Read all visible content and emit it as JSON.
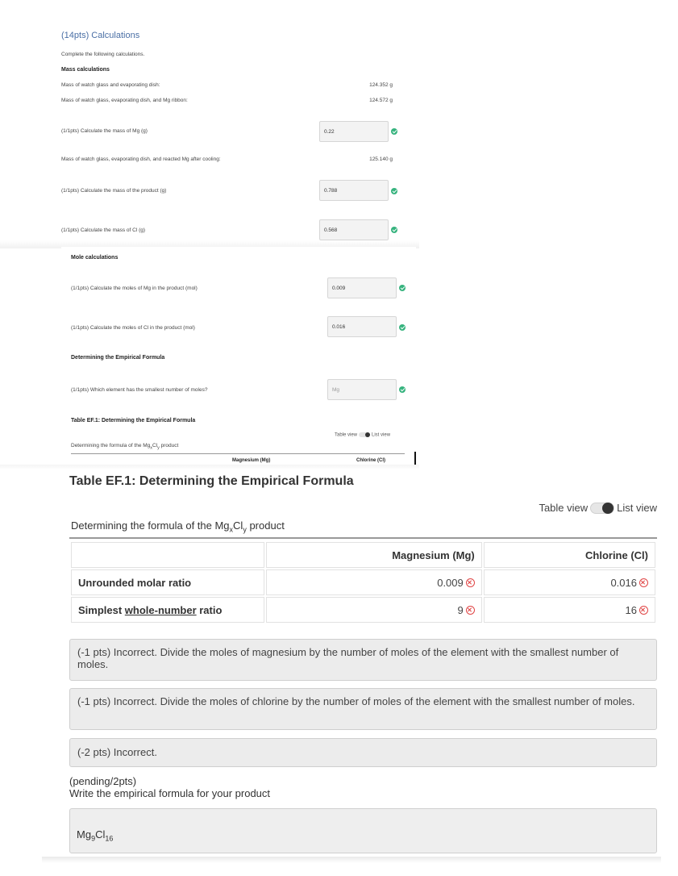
{
  "section": {
    "title": "(14pts) Calculations",
    "instructions": "Complete the following calculations."
  },
  "mass": {
    "heading": "Mass calculations",
    "rows": [
      {
        "label": "Mass of watch glass and evaporating dish:",
        "value": "124.352 g"
      },
      {
        "label": "Mass of watch glass, evaporating dish, and Mg ribbon:",
        "value": "124.572 g"
      }
    ],
    "q1": {
      "label": "(1/1pts)  Calculate the mass of Mg (g)",
      "value": "0.22"
    },
    "after_cooling": {
      "label": "Mass of watch glass, evaporating dish, and reacted Mg after cooling:",
      "value": "125.140 g"
    },
    "q2": {
      "label": "(1/1pts)  Calculate the mass of the product (g)",
      "value": "0.788"
    },
    "q3": {
      "label": "(1/1pts)  Calculate the mass of Cl (g)",
      "value": "0.568"
    }
  },
  "mole": {
    "heading": "Mole calculations",
    "q1": {
      "label": "(1/1pts)  Calculate the moles of Mg in the product (mol)",
      "value": "0.009"
    },
    "q2": {
      "label": "(1/1pts)  Calculate the moles of Cl in the product (mol)",
      "value": "0.016"
    }
  },
  "empirical": {
    "heading": "Determining the Empirical Formula",
    "q1": {
      "label": "(1/1pts)  Which element has the smallest number of moles?",
      "value": "Mg"
    }
  },
  "table_small": {
    "title": "Table EF.1: Determining the Empirical Formula",
    "toggle_table": "Table view",
    "toggle_list": "List view",
    "caption_prefix": "Determining the formula of the Mg",
    "caption_x": "x",
    "caption_mid": "Cl",
    "caption_y": "y",
    "caption_suffix": " product",
    "col_mg": "Magnesium (Mg)",
    "col_cl": "Chlorine (Cl)"
  },
  "table": {
    "title": "Table EF.1: Determining the Empirical Formula",
    "toggle_table": "Table view",
    "toggle_list": "List view",
    "caption_prefix": "Determining the formula of the Mg",
    "caption_x": "x",
    "caption_mid": "Cl",
    "caption_y": "y",
    "caption_suffix": " product",
    "columns": [
      "",
      "Magnesium (Mg)",
      "Chlorine (Cl)"
    ],
    "row1": {
      "label": "Unrounded molar ratio",
      "mg": "0.009",
      "cl": "0.016"
    },
    "row2": {
      "label_pre": "Simplest ",
      "label_ul": "whole-number",
      "label_post": " ratio",
      "mg": "9",
      "cl": "16"
    }
  },
  "feedback": [
    "(-1 pts) Incorrect. Divide the moles of magnesium by the number of moles of the element with the smallest number of moles.",
    "(-1 pts) Incorrect. Divide the moles of chlorine by the number of moles of the element with the smallest number of moles.",
    "(-2 pts) Incorrect."
  ],
  "formula_q": {
    "points": "(pending/2pts)",
    "prompt": "Write the empirical formula for your product",
    "answer_mg": "Mg",
    "answer_mg_sub": "9",
    "answer_cl": "Cl",
    "answer_cl_sub": "16"
  },
  "colors": {
    "correct": "#36b37e",
    "incorrect": "#e04545",
    "title_link": "#4a6fa5"
  },
  "icons": {
    "correct": "check-circle-icon",
    "incorrect": "x-circle-icon"
  }
}
